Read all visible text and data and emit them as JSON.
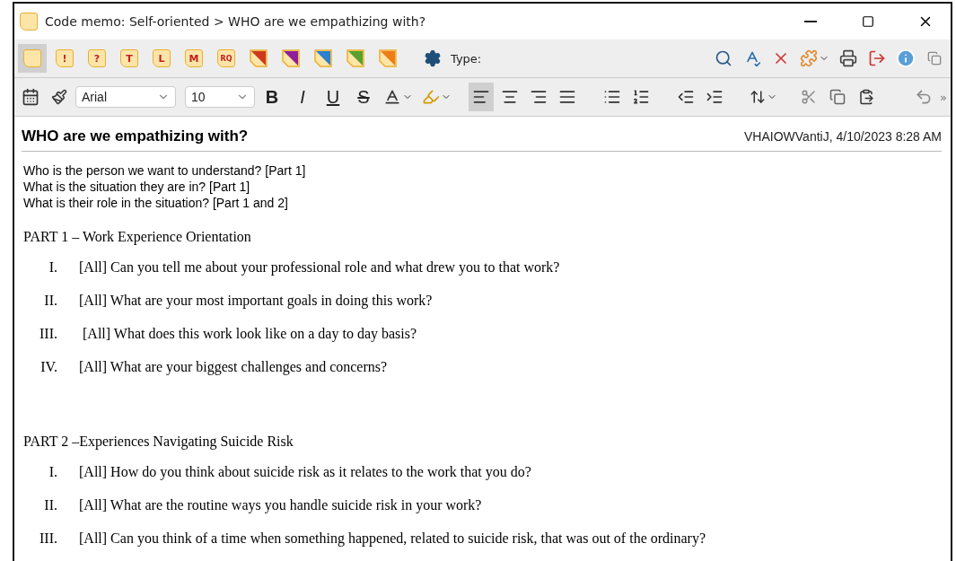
{
  "window": {
    "title": "Code memo: Self-oriented > WHO are we empathizing with?"
  },
  "memo_toolbar": {
    "memo_types": [
      {
        "kind": "plain",
        "selected": true
      },
      {
        "kind": "letter",
        "label": "!",
        "selected": false
      },
      {
        "kind": "letter",
        "label": "?",
        "selected": false
      },
      {
        "kind": "letter",
        "label": "T",
        "selected": false
      },
      {
        "kind": "letter",
        "label": "L",
        "selected": false
      },
      {
        "kind": "letter",
        "label": "M",
        "selected": false
      },
      {
        "kind": "letter",
        "label": "RQ",
        "selected": false
      },
      {
        "kind": "corner",
        "color": "#d0381e",
        "selected": false
      },
      {
        "kind": "corner",
        "color": "#8e1f99",
        "selected": false
      },
      {
        "kind": "corner",
        "color": "#2d7fd0",
        "selected": false
      },
      {
        "kind": "corner",
        "color": "#5aa02c",
        "selected": false
      },
      {
        "kind": "corner",
        "color": "#ee7d16",
        "selected": false
      }
    ],
    "type_label": "Type:",
    "tools": [
      {
        "kind": "search"
      },
      {
        "kind": "spellcheck"
      },
      {
        "kind": "delete"
      },
      {
        "kind": "puzzle"
      },
      {
        "kind": "print"
      },
      {
        "kind": "export"
      },
      {
        "kind": "info"
      },
      {
        "kind": "restore"
      }
    ]
  },
  "format_toolbar": {
    "font": "Arial",
    "size": "10",
    "styles": [
      {
        "kind": "bold",
        "label": "B"
      },
      {
        "kind": "italic",
        "label": "I"
      },
      {
        "kind": "underline",
        "label": "U"
      },
      {
        "kind": "strike",
        "label": "S"
      }
    ],
    "alignment": [
      {
        "kind": "left",
        "selected": true
      },
      {
        "kind": "center",
        "selected": false
      },
      {
        "kind": "right",
        "selected": false
      },
      {
        "kind": "justify",
        "selected": false
      }
    ],
    "more": "»"
  },
  "memo": {
    "heading": "WHO are we empathizing with?",
    "author": "VHAIOWVantiJ, 4/10/2023 8:28 AM",
    "intro": [
      "Who is the person we want to understand? [Part 1]",
      "What is the situation they are in? [Part 1]",
      "What is their role in the situation? [Part 1 and 2]"
    ],
    "parts": [
      {
        "title": "PART 1 – Work Experience Orientation",
        "questions": [
          {
            "numeral": "I.",
            "text": "[All] Can you tell me about your professional role and what drew you to that work?"
          },
          {
            "numeral": "II.",
            "text": "[All] What are your most important goals in doing this work?"
          },
          {
            "numeral": "III.",
            "text": " [All] What does this work look like on a day to day basis?"
          },
          {
            "numeral": "IV.",
            "text": "[All] What are your biggest challenges and concerns?"
          }
        ]
      },
      {
        "title": "PART 2 –Experiences Navigating Suicide Risk",
        "questions": [
          {
            "numeral": "I.",
            "text": "[All] How do you think about suicide risk as it relates to the work that you do?"
          },
          {
            "numeral": "II.",
            "text": "[All] What are the routine ways you handle suicide risk in your work?"
          },
          {
            "numeral": "III.",
            "text": "[All] Can you think of a time when something happened, related to suicide risk, that was out of the ordinary?"
          }
        ]
      }
    ]
  }
}
